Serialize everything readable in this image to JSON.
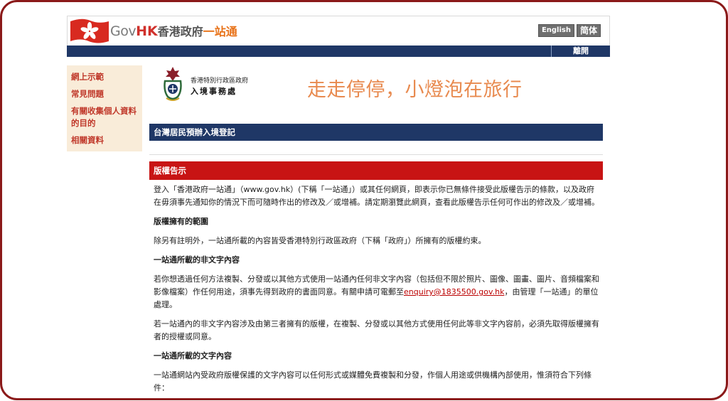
{
  "header": {
    "logo_gov": "Gov",
    "logo_hk": "HK",
    "logo_zh": "香港政府",
    "logo_zh2": "一站通",
    "lang_english": "English",
    "lang_simplified": "简体",
    "nav_exit": "離開"
  },
  "sidebar": {
    "items": [
      {
        "label": "網上示範"
      },
      {
        "label": "常見問題"
      },
      {
        "label": "有關收集個人資料的目的"
      },
      {
        "label": "相關資料"
      }
    ]
  },
  "department": {
    "line1": "香港特別行政區政府",
    "line2": "入境事務處"
  },
  "banner": {
    "text": "走走停停，小燈泡在旅行"
  },
  "page": {
    "section_title": "台灣居民預辦入境登記",
    "notice_title": "版權告示",
    "p1": "登入「香港政府一站通」（www.gov.hk）(下稱「一站通」）或其任何網頁，即表示你已無條件接受此版權告示的條款，以及政府在毋須事先通知你的情況下而可隨時作出的修改及／或增補。請定期瀏覽此網頁，查看此版權告示任何可作出的修改及／或增補。",
    "h1": "版權擁有的範圍",
    "p2": "除另有註明外，一站通所載的內容皆受香港特別行政區政府（下稱「政府」）所擁有的版權約束。",
    "h2": "一站通所載的非文字內容",
    "p3_before": "若你想透過任何方法複製、分發或以其他方式使用一站通內任何非文字內容（包括但不限於照片、圖像、圖畫、圖片、音頻檔案和影像檔案）作任何用途，須事先得到政府的書面同意。有關申請可電郵至",
    "p3_link": "enquiry@1835500.gov.hk",
    "p3_after": "，由管理「一站通」的單位處理。",
    "p4": "若一站通內的非文字內容涉及由第三者擁有的版權，在複製、分發或以其他方式使用任何此等非文字內容前，必須先取得版權擁有者的授權或同意。",
    "h3": "一站通所載的文字內容",
    "p5": "一站通網站內受政府版權保護的文字內容可以任何形式或媒體免費複製和分發，作個人用途或供機構內部使用，惟須符合下列條件："
  },
  "colors": {
    "navy": "#1f3766",
    "red_bar": "#c81414",
    "sidebar_bg": "#f9ecd9",
    "sidebar_text": "#c0392b",
    "banner_text": "#e88a4f",
    "frame": "#8b1a1a"
  },
  "icons": {
    "flag": "hk-flag-icon",
    "crest": "immigration-crest-icon"
  }
}
